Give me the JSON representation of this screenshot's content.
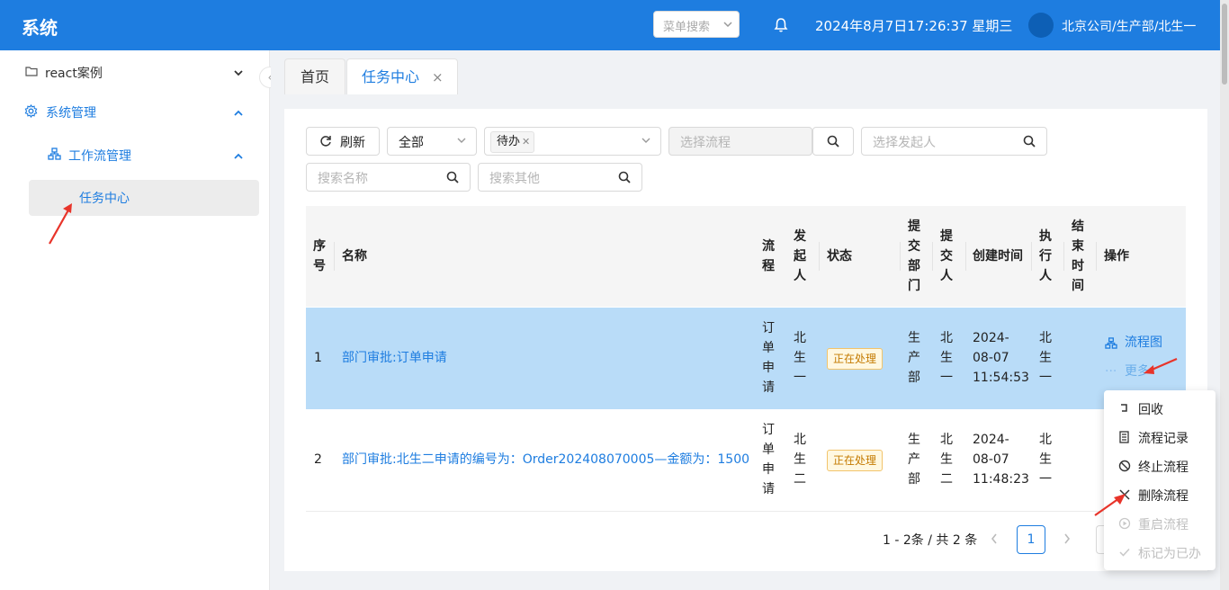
{
  "header": {
    "app_title": "系统",
    "menu_search_placeholder": "菜单搜索",
    "datetime": "2024年8月7日17:26:37 星期三",
    "user": "北京公司/生产部/北生一"
  },
  "sidebar": {
    "items": [
      {
        "label": "react案例",
        "icon": "folder-icon"
      },
      {
        "label": "系统管理",
        "icon": "gear-icon"
      },
      {
        "label": "工作流管理",
        "icon": "workflow-icon"
      },
      {
        "label": "任务中心"
      }
    ]
  },
  "tabs": [
    {
      "label": "首页"
    },
    {
      "label": "任务中心",
      "close": "×"
    }
  ],
  "filters": {
    "refresh_label": "刷新",
    "scope_value": "全部",
    "status_tag": "待办",
    "flow_placeholder": "选择流程",
    "initiator_placeholder": "选择发起人",
    "name_placeholder": "搜索名称",
    "other_placeholder": "搜索其他"
  },
  "table": {
    "headers": {
      "index": [
        "序",
        "号"
      ],
      "name": "名称",
      "flow": [
        "流",
        "程"
      ],
      "initiator": [
        "发",
        "起",
        "人"
      ],
      "status": "状态",
      "dept": [
        "提",
        "交",
        "部",
        "门"
      ],
      "submitter": [
        "提",
        "交",
        "人"
      ],
      "created": "创建时间",
      "executor": [
        "执",
        "行",
        "人"
      ],
      "end_time": [
        "结",
        "束",
        "时",
        "间"
      ],
      "action": "操作"
    },
    "rows": [
      {
        "index": "1",
        "name": "部门审批:订单申请",
        "flow": [
          "订",
          "单",
          "申",
          "请"
        ],
        "initiator": [
          "北",
          "生",
          "一"
        ],
        "status": "正在处理",
        "dept": [
          "生",
          "产",
          "部"
        ],
        "submitter": [
          "北",
          "生",
          "一"
        ],
        "created": [
          "2024-",
          "08-07",
          "11:54:53"
        ],
        "executor": [
          "北",
          "生",
          "一"
        ],
        "flowchart": "流程图",
        "more": "更多",
        "more_dots": "···"
      },
      {
        "index": "2",
        "name": "部门审批:北生二申请的编号为：Order202408070005—金额为：1500",
        "flow": [
          "订",
          "单",
          "申",
          "请"
        ],
        "initiator": [
          "北",
          "生",
          "二"
        ],
        "status": "正在处理",
        "dept": [
          "生",
          "产",
          "部"
        ],
        "submitter": [
          "北",
          "生",
          "二"
        ],
        "created": [
          "2024-",
          "08-07",
          "11:48:23"
        ],
        "executor": [
          "北",
          "生",
          "一"
        ]
      }
    ]
  },
  "pagination": {
    "summary": "1 - 2条 / 共 2 条",
    "current": "1"
  },
  "more_menu": [
    {
      "label": "回收",
      "icon": "recall-icon",
      "disabled": false
    },
    {
      "label": "流程记录",
      "icon": "record-icon",
      "disabled": false
    },
    {
      "label": "终止流程",
      "icon": "stop-icon",
      "disabled": false
    },
    {
      "label": "删除流程",
      "icon": "delete-icon",
      "disabled": false
    },
    {
      "label": "重启流程",
      "icon": "restart-icon",
      "disabled": true
    },
    {
      "label": "标记为已办",
      "icon": "check-icon",
      "disabled": true
    }
  ],
  "colors": {
    "primary": "#1e7de0",
    "selected_row": "#b9dcf8",
    "annotation_arrow": "#e8342a"
  }
}
